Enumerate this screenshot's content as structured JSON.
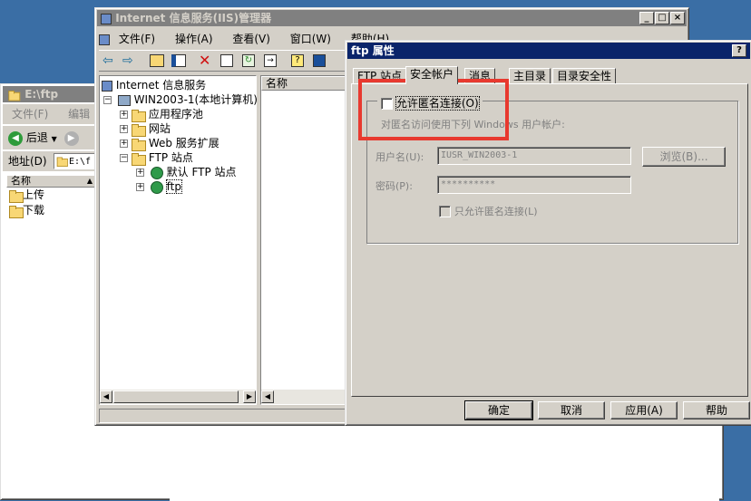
{
  "explorer": {
    "title": "E:\\ftp",
    "menu": [
      "文件(F)",
      "编辑"
    ],
    "back_label": "后退",
    "address_label": "地址(D)",
    "address_value": "E:\\f",
    "column_name": "名称",
    "items": [
      "上传",
      "下载"
    ]
  },
  "iis": {
    "title": "Internet 信息服务(IIS)管理器",
    "menu": [
      "文件(F)",
      "操作(A)",
      "查看(V)",
      "窗口(W)",
      "帮助(H)"
    ],
    "tree": {
      "root": "Internet 信息服务",
      "server": "WIN2003-1(本地计算机)",
      "nodes": [
        "应用程序池",
        "网站",
        "Web 服务扩展",
        "FTP 站点"
      ],
      "ftp_children": [
        "默认 FTP 站点",
        "ftp"
      ]
    },
    "list_header": "名称"
  },
  "dialog": {
    "title": "ftp 属性",
    "help_btn": "?",
    "close_btn": "×",
    "tabs": [
      "FTP 站点",
      "安全帐户",
      "消息",
      "主目录",
      "目录安全性"
    ],
    "active_tab": "安全帐户",
    "allow_anonymous_label": "允许匿名连接(O)",
    "anon_desc": "对匿名访问使用下列 Windows 用户帐户:",
    "username_label": "用户名(U):",
    "username_value": "IUSR_WIN2003-1",
    "browse_label": "浏览(B)...",
    "password_label": "密码(P):",
    "password_value": "**********",
    "only_anon_label": "只允许匿名连接(L)",
    "buttons": {
      "ok": "确定",
      "cancel": "取消",
      "apply": "应用(A)",
      "help": "帮助"
    }
  },
  "highlight_color": "#e8392f"
}
